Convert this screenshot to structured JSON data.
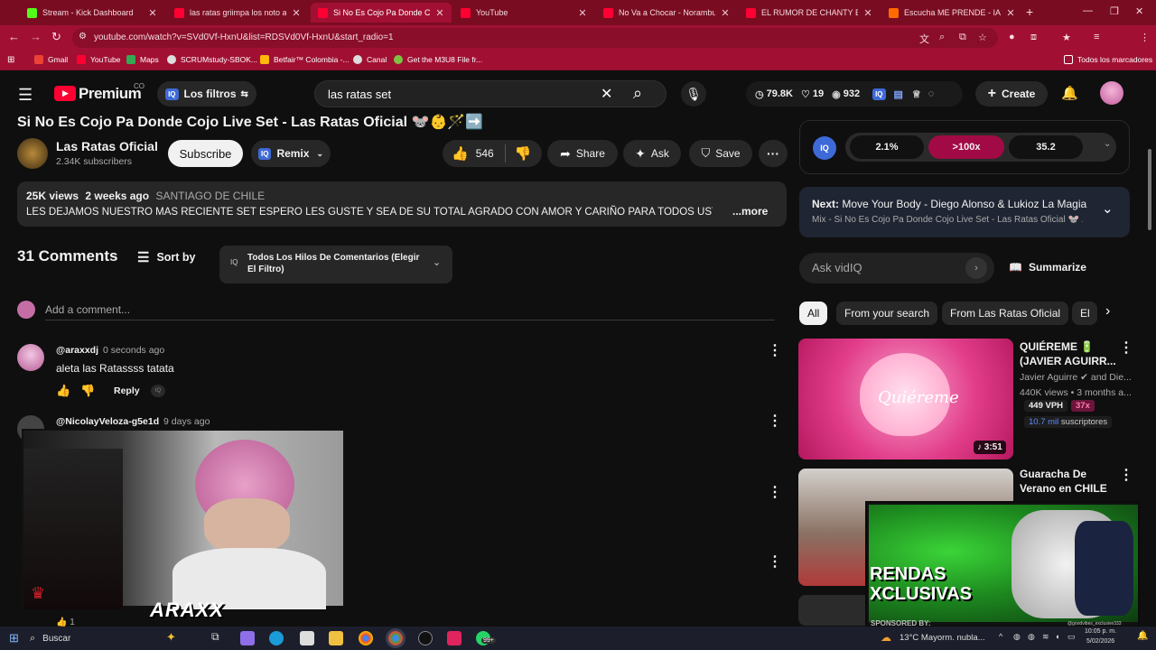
{
  "tabs": [
    {
      "label": "Stream - Kick Dashboard",
      "color": "#53fc18"
    },
    {
      "label": "las ratas griimpa los noto asustados",
      "color": "#ff0033"
    },
    {
      "label": "Si No Es Cojo Pa Donde Cojo Live Set",
      "color": "#ff0033"
    },
    {
      "label": "YouTube",
      "color": "#ff0033"
    },
    {
      "label": "No Va a Chocar - Norambuena",
      "color": "#ff0033"
    },
    {
      "label": "EL RUMOR DE CHANTY EN ME",
      "color": "#ff0033"
    },
    {
      "label": "Escucha ME PRENDE - IAN ARAN",
      "color": "#ff6a00"
    }
  ],
  "browser": {
    "url": "youtube.com/watch?v=SVd0Vf-HxnU&list=RDSVd0Vf-HxnU&start_radio=1",
    "new_tab": "+"
  },
  "bookmarks": [
    {
      "label": "Gmail",
      "color": "#ea4335"
    },
    {
      "label": "YouTube",
      "color": "#ff0033"
    },
    {
      "label": "Maps",
      "color": "#34a853"
    },
    {
      "label": "SCRUMstudy-SBOK...",
      "color": "#dddddd"
    },
    {
      "label": "Betfair™ Colombia -...",
      "color": "#ffb80c"
    },
    {
      "label": "Canal",
      "color": "#dddddd"
    },
    {
      "label": "Get the M3U8 File fr...",
      "color": "#7cc242"
    }
  ],
  "bookmarks_all": "Todos los marcadores",
  "yt": {
    "logo": "Premium",
    "region": "CO",
    "filters": "Los filtros",
    "search_query": "las ratas set",
    "stats": {
      "views": "79.8K",
      "likes": "19",
      "watching": "932"
    },
    "create": "Create"
  },
  "video": {
    "title": "Si No Es Cojo Pa Donde Cojo Live Set - Las Ratas Oficial 🐭👶🪄➡️",
    "channel": "Las Ratas Oficial",
    "subscribers": "2.34K subscribers",
    "subscribe": "Subscribe",
    "remix": "Remix",
    "likes": "546",
    "share": "Share",
    "ask": "Ask",
    "save": "Save",
    "views": "25K views",
    "date": "2 weeks ago",
    "location": "SANTIAGO DE CHILE",
    "description": "LES DEJAMOS NUESTRO MAS RECIENTE SET ESPERO LES GUSTE Y SEA DE SU TOTAL AGRADO CON AMOR Y CARIÑO PARA TODOS USTEDES. ❤️ 🐭",
    "more": "...more"
  },
  "comments": {
    "count": "31 Comments",
    "sort": "Sort by",
    "filter": "Todos Los Hilos De Comentarios (Elegir El Filtro)",
    "add_placeholder": "Add a comment...",
    "items": [
      {
        "author": "@araxxdj",
        "time": "0 seconds ago",
        "text": "aleta las Ratassss tatata",
        "reply": "Reply"
      },
      {
        "author": "@NicolayVeloza-g5e1d",
        "time": "9 days ago"
      }
    ],
    "like_count": "1"
  },
  "overlay": {
    "brand": "ARAXX"
  },
  "sidebar": {
    "vidiq": {
      "a": "2.1%",
      "b": ">100x",
      "c": "35.2"
    },
    "next_label": "Next:",
    "next_title": "Move Your Body - Diego Alonso & Lukioz La Magia",
    "next_sub": "Mix - Si No Es Cojo Pa Donde Cojo Live Set - Las Ratas Oficial 🐭 ...",
    "ask_placeholder": "Ask vidIQ",
    "summarize": "Summarize",
    "chips": [
      "All",
      "From your search",
      "From Las Ratas Oficial",
      "El"
    ],
    "videos": [
      {
        "title": "QUIÉREME 🔋 (JAVIER AGUIRR...",
        "channel": "Javier Aguirre",
        "channel_extra": "and Die...",
        "meta": "440K views • 3 months a...",
        "vph": "449 VPH",
        "mult": "37x",
        "subs_num": "10.7 mil",
        "subs_label": "suscriptores",
        "duration": "3:51",
        "thumb_text": "Quiéreme"
      },
      {
        "title": "Guaracha De Verano en CHILE ..."
      }
    ],
    "ad": {
      "text1": "RENDAS",
      "text2": "XCLUSIVAS",
      "sponsored": "SPONSORED BY:",
      "handle": "@goodvibes_exclusive333"
    }
  },
  "taskbar": {
    "search": "Buscar",
    "weather": "13°C  Mayorm. nubla...",
    "time": "10:05 p. m.",
    "date": "5/02/2026",
    "badge": "99+"
  }
}
